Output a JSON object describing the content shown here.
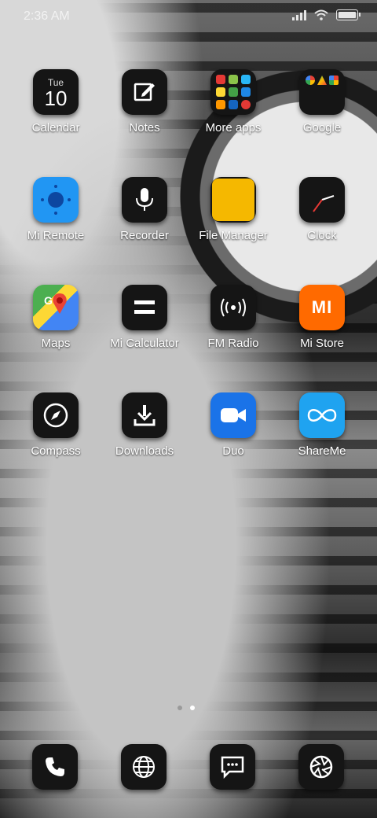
{
  "status": {
    "time": "2:36 AM",
    "battery_level": 1.0
  },
  "apps": [
    {
      "label": "Calendar",
      "icon": "calendar-icon",
      "day": "Tue",
      "date": "10"
    },
    {
      "label": "Notes",
      "icon": "notes-icon"
    },
    {
      "label": "More apps",
      "icon": "folder-icon"
    },
    {
      "label": "Google",
      "icon": "folder-icon"
    },
    {
      "label": "Mi Remote",
      "icon": "remote-icon"
    },
    {
      "label": "Recorder",
      "icon": "microphone-icon"
    },
    {
      "label": "File Manager",
      "icon": "folder-file-icon"
    },
    {
      "label": "Clock",
      "icon": "clock-icon"
    },
    {
      "label": "Maps",
      "icon": "maps-icon"
    },
    {
      "label": "Mi Calculator",
      "icon": "calculator-icon"
    },
    {
      "label": "FM Radio",
      "icon": "radio-icon"
    },
    {
      "label": "Mi Store",
      "icon": "mi-store-icon",
      "logo_text": "MI"
    },
    {
      "label": "Compass",
      "icon": "compass-icon"
    },
    {
      "label": "Downloads",
      "icon": "download-icon"
    },
    {
      "label": "Duo",
      "icon": "video-camera-icon"
    },
    {
      "label": "ShareMe",
      "icon": "share-infinity-icon"
    }
  ],
  "dock": [
    {
      "name": "phone",
      "icon": "phone-icon"
    },
    {
      "name": "browser",
      "icon": "globe-icon"
    },
    {
      "name": "messages",
      "icon": "message-icon"
    },
    {
      "name": "camera",
      "icon": "camera-shutter-icon"
    }
  ],
  "pager": {
    "pages": 2,
    "current": 2
  },
  "colors": {
    "mi_store": "#ff6a00",
    "file_manager": "#f5b800",
    "duo": "#1a73e8",
    "shareme": "#1fa3f0",
    "mi_remote": "#2196f3"
  }
}
